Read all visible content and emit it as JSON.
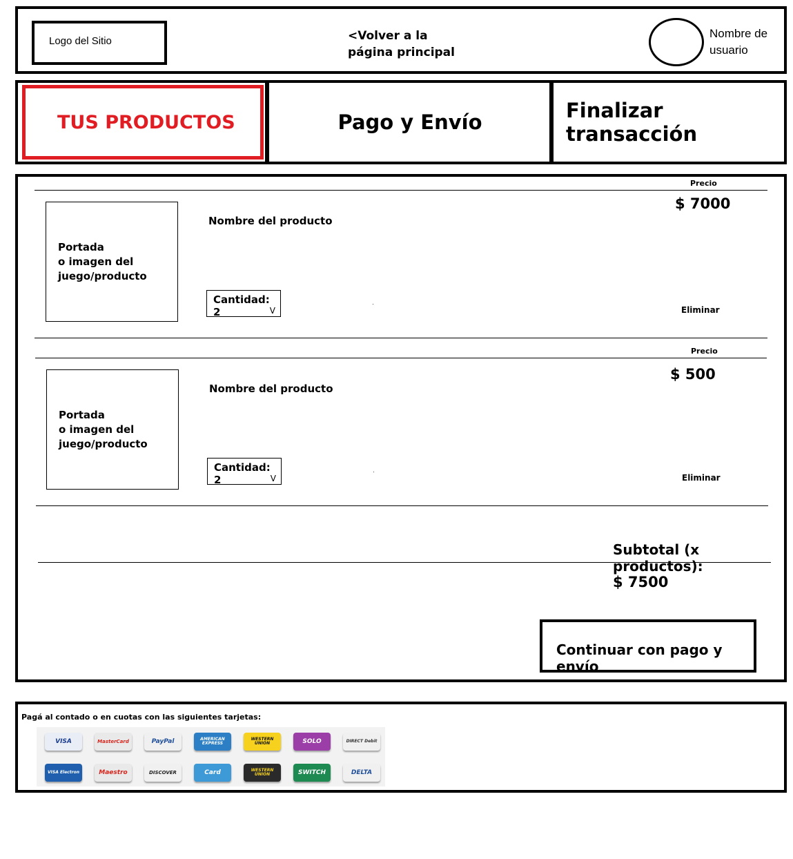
{
  "header": {
    "logo_text": "Logo del Sitio",
    "back_link_line1": "<Volver a la",
    "back_link_line2": "página principal",
    "username_line1": "Nombre de",
    "username_line2": "usuario"
  },
  "steps": [
    {
      "label": "TUS PRODUCTOS",
      "active": true
    },
    {
      "label": "Pago y Envío",
      "active": false
    },
    {
      "label": "Finalizar transacción",
      "active": false
    }
  ],
  "cart": {
    "items": [
      {
        "price_header": "Precio",
        "price": "$ 7000",
        "image_line1": "Portada",
        "image_line2": " o imagen del",
        "image_line3": "juego/producto",
        "name": "Nombre del producto",
        "quantity": "Cantidad: 2",
        "remove_label": "Eliminar"
      },
      {
        "price_header": "Precio",
        "price": "$ 500",
        "image_line1": "Portada",
        "image_line2": " o imagen del",
        "image_line3": "juego/producto",
        "name": "Nombre del producto",
        "quantity": "Cantidad: 2",
        "remove_label": "Eliminar"
      }
    ],
    "subtotal_label": "Subtotal (x productos):",
    "subtotal_value": "$ 7500",
    "continue_label": "Continuar con pago y envío"
  },
  "payments": {
    "text": "Pagá al contado o en cuotas con las siguientes tarjetas:",
    "cards": [
      {
        "label": "VISA",
        "bg": "#e9edf5",
        "fg": "#1a3d8f"
      },
      {
        "label": "MasterCard",
        "bg": "#e9e9e9",
        "fg": "#d9251c"
      },
      {
        "label": "PayPal",
        "bg": "#f0f0f0",
        "fg": "#1f4f9a"
      },
      {
        "label": "AMERICAN EXPRESS",
        "bg": "#2c7fc4",
        "fg": "#ffffff"
      },
      {
        "label": "WESTERN UNION",
        "bg": "#f6d21e",
        "fg": "#111111"
      },
      {
        "label": "SOLO",
        "bg": "#9b3ea8",
        "fg": "#ffffff"
      },
      {
        "label": "DIRECT Debit",
        "bg": "#f0f0f0",
        "fg": "#333333"
      },
      {
        "label": "VISA Electron",
        "bg": "#1f5fae",
        "fg": "#ffffff"
      },
      {
        "label": "Maestro",
        "bg": "#e9e9e9",
        "fg": "#d9251c"
      },
      {
        "label": "DISCOVER",
        "bg": "#f0f0f0",
        "fg": "#222222"
      },
      {
        "label": "Card",
        "bg": "#3d9ad7",
        "fg": "#ffffff"
      },
      {
        "label": "WESTERN UNION",
        "bg": "#2a2a2a",
        "fg": "#f6d21e"
      },
      {
        "label": "SWITCH",
        "bg": "#1d8a52",
        "fg": "#ffffff"
      },
      {
        "label": "DELTA",
        "bg": "#f0f0f0",
        "fg": "#1f4f9a"
      }
    ]
  }
}
